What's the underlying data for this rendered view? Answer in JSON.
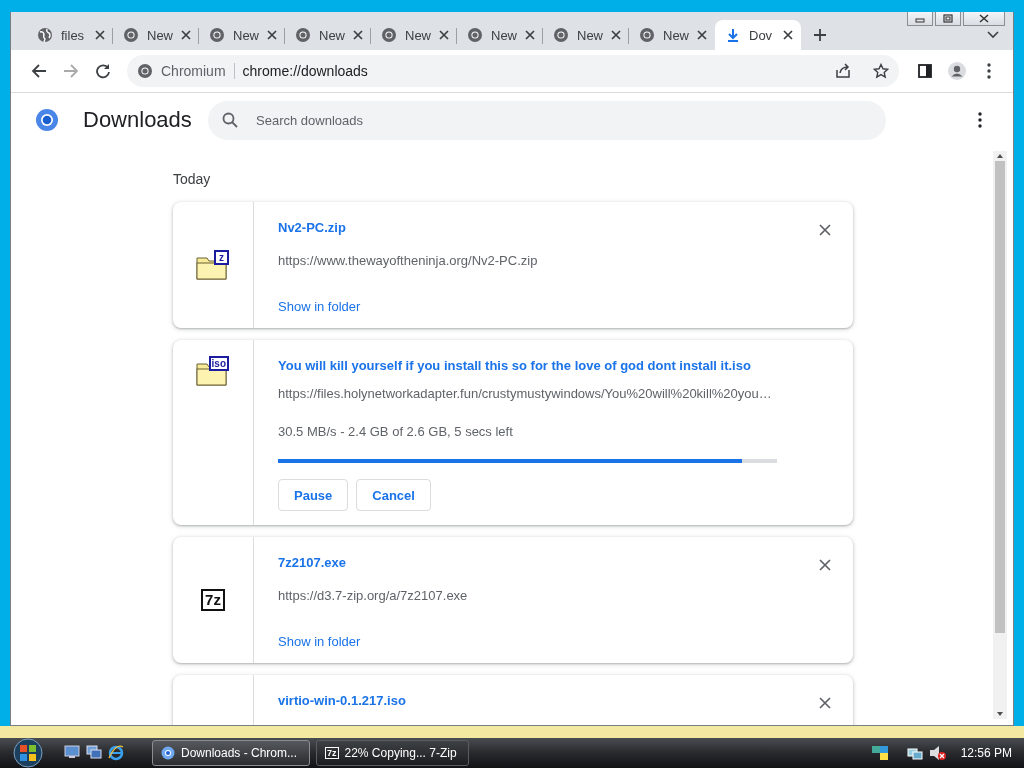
{
  "tabs": [
    {
      "kind": "web",
      "title": "files",
      "selected": false
    },
    {
      "kind": "new",
      "title": "New",
      "selected": false
    },
    {
      "kind": "new",
      "title": "New",
      "selected": false
    },
    {
      "kind": "new",
      "title": "New",
      "selected": false
    },
    {
      "kind": "new",
      "title": "New",
      "selected": false
    },
    {
      "kind": "new",
      "title": "New",
      "selected": false
    },
    {
      "kind": "new",
      "title": "New",
      "selected": false
    },
    {
      "kind": "new",
      "title": "New",
      "selected": false
    },
    {
      "kind": "download",
      "title": "Dov",
      "selected": true
    }
  ],
  "toolbar": {
    "site_label": "Chromium",
    "url": "chrome://downloads"
  },
  "page": {
    "title": "Downloads",
    "search": {
      "placeholder": "Search downloads"
    },
    "section": "Today"
  },
  "downloads": [
    {
      "kind": "done",
      "icon": {
        "kind": "folder",
        "text": "z"
      },
      "name": "Nv2-PC.zip",
      "url": "https://www.thewayoftheninja.org/Nv2-PC.zip",
      "link": "Show in folder"
    },
    {
      "kind": "progress",
      "icon": {
        "kind": "folder",
        "text": "iso"
      },
      "name": "You will kill yourself if you install this so for the love of god dont install it.iso",
      "url": "https://files.holynetworkadapter.fun/crustymustywindows/You%20will%20kill%20you…",
      "status": "30.5 MB/s - 2.4 GB of 2.6 GB, 5 secs left",
      "level": 0.93,
      "buttons": [
        "Pause",
        "Cancel"
      ]
    },
    {
      "kind": "done",
      "icon": {
        "kind": "box",
        "text": "7z"
      },
      "name": "7z2107.exe",
      "url": "https://d3.7-zip.org/a/7z2107.exe",
      "link": "Show in folder"
    },
    {
      "kind": "partial",
      "name": "virtio-win-0.1.217.iso"
    }
  ],
  "taskbar": {
    "tasks": [
      {
        "kind": "browser",
        "title": "Downloads - Chrom...",
        "selected": true
      },
      {
        "kind": "archiver",
        "icon_text": "7z",
        "title": "22% Copying... 7-Zip",
        "selected": false
      }
    ],
    "clock": "12:56 PM"
  }
}
